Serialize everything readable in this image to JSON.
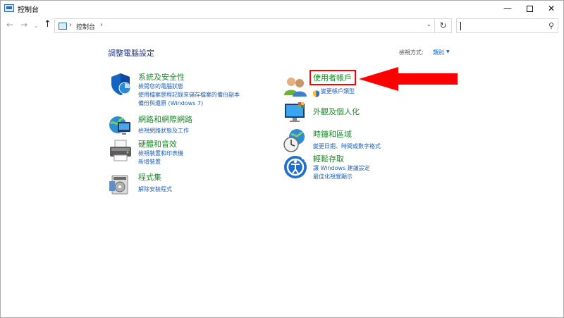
{
  "window": {
    "title": "控制台",
    "minimize_glyph": "—",
    "close_glyph": "✕"
  },
  "nav": {
    "back": "←",
    "forward": "→",
    "recent": "⌄",
    "up": "↑",
    "separator": "›",
    "breadcrumb": "控制台",
    "dropdown": "⌄",
    "refresh": "↻",
    "search_glyph": "⚲",
    "search_placeholder": ""
  },
  "main": {
    "heading": "調整電腦設定",
    "view_by_label": "檢視方式:",
    "view_by_value": "類別",
    "view_by_arrow": "▼"
  },
  "categories": {
    "system_security": {
      "title": "系統及安全性",
      "links": [
        "檢閱您的電腦狀態",
        "使用檔案歷程記錄來儲存檔案的備份副本",
        "備份與還原 (Windows 7)"
      ]
    },
    "network": {
      "title": "網路和網際網路",
      "links": [
        "檢視網路狀態及工作"
      ]
    },
    "hardware_sound": {
      "title": "硬體和音效",
      "links": [
        "檢視裝置和印表機",
        "新增裝置"
      ]
    },
    "programs": {
      "title": "程式集",
      "links": [
        "解除安裝程式"
      ]
    },
    "user_accounts": {
      "title": "使用者帳戶",
      "links": [
        "變更帳戶類型"
      ]
    },
    "appearance": {
      "title": "外觀及個人化",
      "links": []
    },
    "clock_region": {
      "title": "時鐘和區域",
      "links": [
        "變更日期、時間或數字格式"
      ]
    },
    "ease_access": {
      "title": "輕鬆存取",
      "links": [
        "讓 Windows 建議設定",
        "最佳化視覺顯示"
      ]
    }
  },
  "colors": {
    "category_title": "#1f8b2f",
    "link": "#1d62b5",
    "heading": "#1e3287",
    "callout": "#ff0000"
  }
}
